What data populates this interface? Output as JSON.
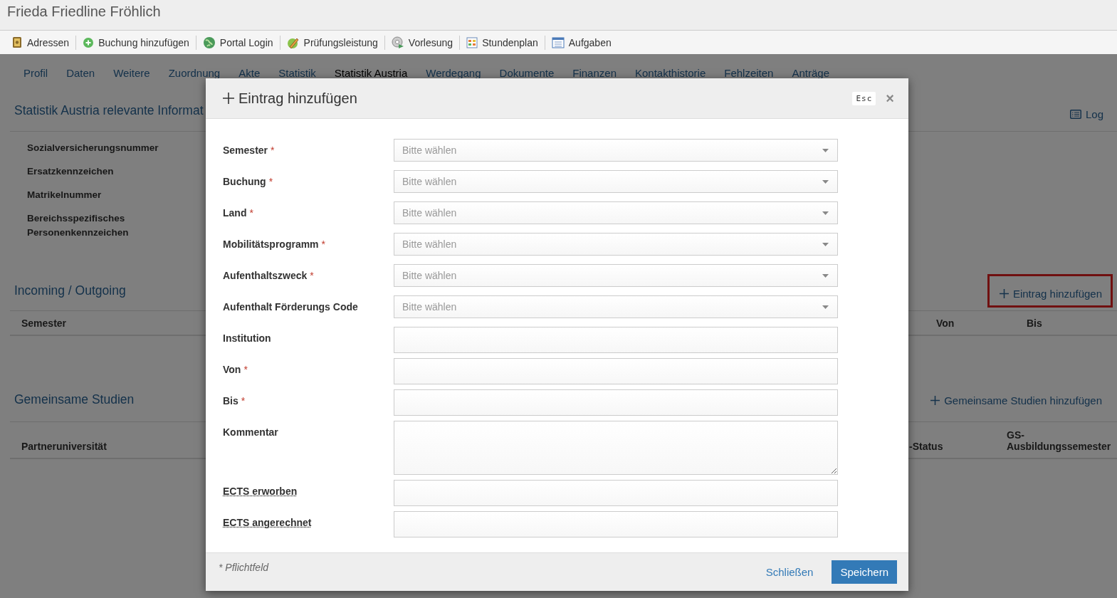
{
  "window": {
    "title": "Frieda Friedline Fröhlich"
  },
  "toolbar": [
    {
      "label": "Adressen"
    },
    {
      "label": "Buchung hinzufügen"
    },
    {
      "label": "Portal Login"
    },
    {
      "label": "Prüfungsleistung"
    },
    {
      "label": "Vorlesung"
    },
    {
      "label": "Stundenplan"
    },
    {
      "label": "Aufgaben"
    }
  ],
  "tabs": [
    {
      "label": "Profil",
      "selected": false
    },
    {
      "label": "Daten",
      "selected": false
    },
    {
      "label": "Weitere",
      "selected": false
    },
    {
      "label": "Zuordnung",
      "selected": false
    },
    {
      "label": "Akte",
      "selected": false
    },
    {
      "label": "Statistik",
      "selected": false
    },
    {
      "label": "Statistik Austria",
      "selected": true
    },
    {
      "label": "Werdegang",
      "selected": false
    },
    {
      "label": "Dokumente",
      "selected": false
    },
    {
      "label": "Finanzen",
      "selected": false
    },
    {
      "label": "Kontakthistorie",
      "selected": false
    },
    {
      "label": "Fehlzeiten",
      "selected": false
    },
    {
      "label": "Anträge",
      "selected": false
    }
  ],
  "statistik_section": {
    "title": "Statistik Austria relevante Informat",
    "log_button": "Log",
    "fields": [
      "Sozialversicherungsnummer",
      "Ersatzkennzeichen",
      "Matrikelnummer",
      "Bereichsspezifisches Personenkennzeichen"
    ]
  },
  "incoming_section": {
    "title": "Incoming / Outgoing",
    "add_link": {
      "label": "Eintrag hinzufügen",
      "highlighted": true
    },
    "columns": [
      "Semester",
      "Von",
      "Bis"
    ]
  },
  "studien_section": {
    "title": "Gemeinsame Studien",
    "add_link": {
      "label": "Gemeinsame Studien hinzufügen",
      "highlighted": false
    },
    "columns": [
      "Partneruniversität",
      "-Status",
      "GS-Ausbildungssemester"
    ]
  },
  "dialog": {
    "title": "Eintrag hinzufügen",
    "esc_hint": "Esc",
    "close": "×",
    "fields": [
      {
        "label": "Semester",
        "required_mark": "*",
        "kind": "select",
        "placeholder": "Bitte wählen"
      },
      {
        "label": "Buchung",
        "required_mark": "*",
        "kind": "select",
        "placeholder": "Bitte wählen"
      },
      {
        "label": "Land",
        "required_mark": "*",
        "kind": "select",
        "placeholder": "Bitte wählen"
      },
      {
        "label": "Mobilitätsprogramm",
        "required_mark": "*",
        "kind": "select",
        "placeholder": "Bitte wählen"
      },
      {
        "label": "Aufenthaltszweck",
        "required_mark": "*",
        "kind": "select",
        "placeholder": "Bitte wählen"
      },
      {
        "label": "Aufenthalt Förderungs Code",
        "kind": "select",
        "placeholder": "Bitte wählen"
      },
      {
        "label": "Institution",
        "kind": "text"
      },
      {
        "label": "Von",
        "required_mark": "*",
        "kind": "text"
      },
      {
        "label": "Bis",
        "required_mark": "*",
        "kind": "text"
      },
      {
        "label": "Kommentar",
        "kind": "textarea"
      },
      {
        "label": "ECTS erworben",
        "kind": "text",
        "tooltip": true
      },
      {
        "label": "ECTS angerechnet",
        "kind": "text",
        "tooltip": true
      }
    ],
    "footnote": "* Pflichtfeld",
    "close_button": "Schließen",
    "save_button": "Speichern"
  }
}
